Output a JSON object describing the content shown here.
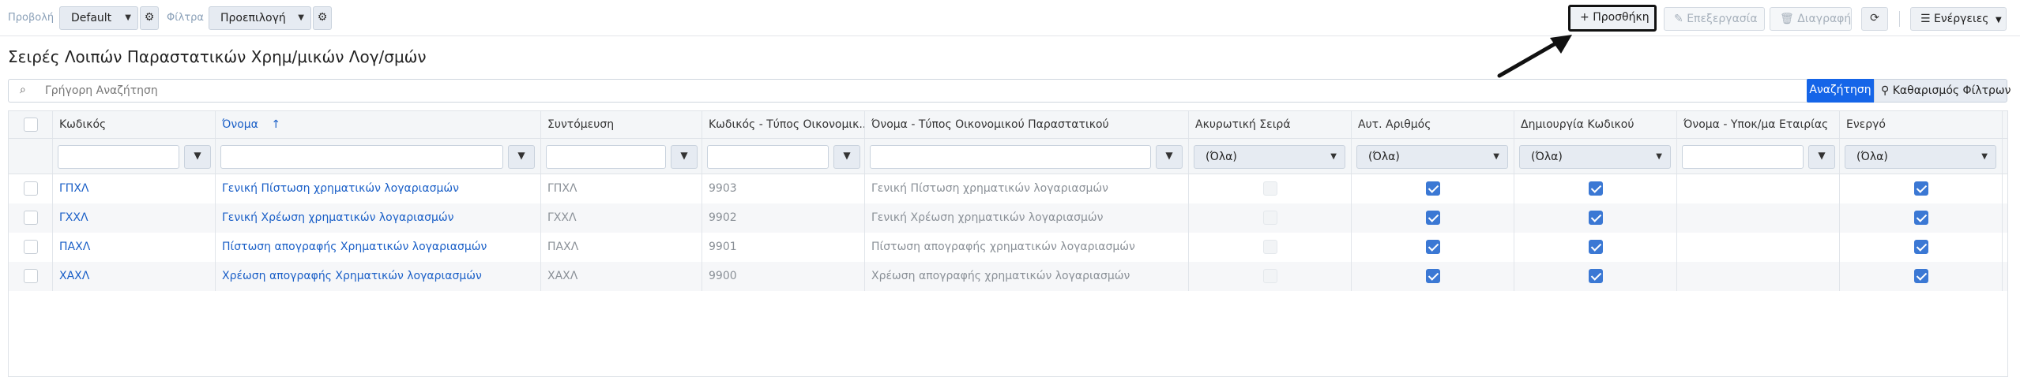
{
  "toolbar": {
    "view_label": "Προβολή",
    "view_value": "Default",
    "filters_label": "Φίλτρα",
    "filters_value": "Προεπιλογή",
    "add_label": "Προσθήκη",
    "edit_label": "Επεξεργασία",
    "delete_label": "Διαγραφή",
    "actions_label": "Ενέργειες"
  },
  "page": {
    "title": "Σειρές Λοιπών Παραστατικών Χρημ/μικών Λογ/σμών"
  },
  "search": {
    "placeholder": "Γρήγορη Αναζήτηση",
    "search_button": "Αναζήτηση",
    "clear_button": "Καθαρισμός Φίλτρων"
  },
  "grid": {
    "columns": [
      {
        "key": "code",
        "label": "Κωδικός"
      },
      {
        "key": "name",
        "label": "Όνομα"
      },
      {
        "key": "abbr",
        "label": "Συντόμευση"
      },
      {
        "key": "doc_code",
        "label": "Κωδικός - Τύπος Οικονομικ..."
      },
      {
        "key": "doc_name",
        "label": "Όνομα - Τύπος Οικονομικού Παραστατικού"
      },
      {
        "key": "cancel",
        "label": "Ακυρωτική Σειρά"
      },
      {
        "key": "autonum",
        "label": "Αυτ. Αριθμός"
      },
      {
        "key": "gencode",
        "label": "Δημιουργία Κωδικού"
      },
      {
        "key": "branch",
        "label": "Όνομα - Υποκ/μα Εταιρίας"
      },
      {
        "key": "active",
        "label": "Ενεργό"
      }
    ],
    "sort_arrow": "↑",
    "select_all": "(Όλα)",
    "rows": [
      {
        "code": "ΓΠΧΛ",
        "name": "Γενική Πίστωση χρηματικών λογαριασμών",
        "abbr": "ΓΠΧΛ",
        "doc_code": "9903",
        "doc_name": "Γενική Πίστωση χρηματικών λογαριασμών",
        "cancel": false,
        "autonum": true,
        "gencode": true,
        "branch": "",
        "active": true
      },
      {
        "code": "ΓΧΧΛ",
        "name": "Γενική Χρέωση χρηματικών λογαριασμών",
        "abbr": "ΓΧΧΛ",
        "doc_code": "9902",
        "doc_name": "Γενική Χρέωση χρηματικών λογαριασμών",
        "cancel": false,
        "autonum": true,
        "gencode": true,
        "branch": "",
        "active": true
      },
      {
        "code": "ΠΑΧΛ",
        "name": "Πίστωση απογραφής Χρηματικών λογαριασμών",
        "abbr": "ΠΑΧΛ",
        "doc_code": "9901",
        "doc_name": "Πίστωση απογραφής χρηματικών λογαριασμών",
        "cancel": false,
        "autonum": true,
        "gencode": true,
        "branch": "",
        "active": true
      },
      {
        "code": "ΧΑΧΛ",
        "name": "Χρέωση απογραφής Χρηματικών λογαριασμών",
        "abbr": "ΧΑΧΛ",
        "doc_code": "9900",
        "doc_name": "Χρέωση απογραφής χρηματικών λογαριασμών",
        "cancel": false,
        "autonum": true,
        "gencode": true,
        "branch": "",
        "active": true
      }
    ]
  }
}
